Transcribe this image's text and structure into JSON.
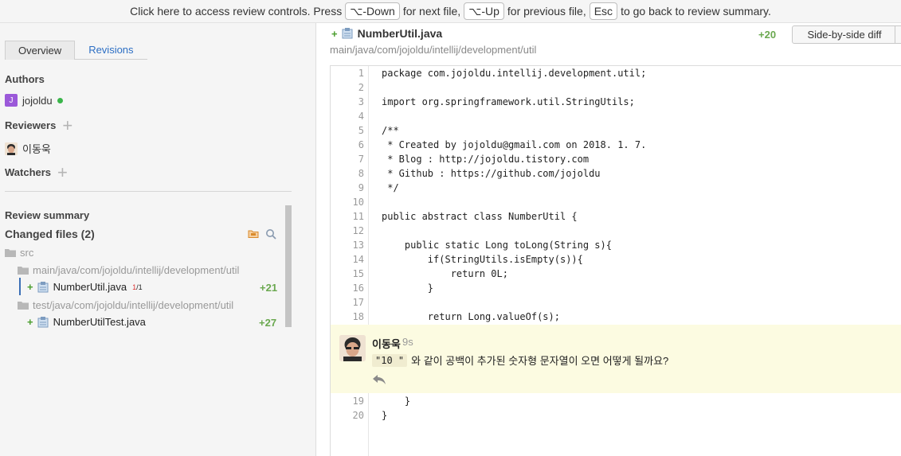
{
  "banner": {
    "text1": "Click here to access review controls. Press",
    "key_next": "⌥-Down",
    "text2": "for next file,",
    "key_prev": "⌥-Up",
    "text3": "for previous file,",
    "key_esc": "Esc",
    "text4": "to go back to review summary."
  },
  "sidebar": {
    "tabs": [
      {
        "label": "Overview",
        "active": true
      },
      {
        "label": "Revisions",
        "active": false
      }
    ],
    "authors_title": "Authors",
    "author": {
      "initial": "J",
      "name": "jojoldu",
      "online": true
    },
    "reviewers_title": "Reviewers",
    "reviewer": {
      "name": "이동욱"
    },
    "watchers_title": "Watchers",
    "review_summary": "Review summary",
    "changed_files": "Changed files (2)",
    "tree": {
      "root": "src",
      "folder1": "main/java/com/jojoldu/intellij/development/util",
      "file1": {
        "name": "NumberUtil.java",
        "comments_unread": "1",
        "comments_sep": "/",
        "comments_total": "1",
        "added": "+21"
      },
      "folder2": "test/java/com/jojoldu/intellij/development/util",
      "file2": {
        "name": "NumberUtilTest.java",
        "added": "+27"
      }
    }
  },
  "main": {
    "file_name": "NumberUtil.java",
    "file_path": "main/java/com/jojoldu/intellij/development/util",
    "added": "+20",
    "side_by_side": "Side-by-side diff",
    "lines_before": [
      {
        "n": "1",
        "code": "package com.jojoldu.intellij.development.util;"
      },
      {
        "n": "2",
        "code": ""
      },
      {
        "n": "3",
        "code": "import org.springframework.util.StringUtils;"
      },
      {
        "n": "4",
        "code": ""
      },
      {
        "n": "5",
        "code": "/**"
      },
      {
        "n": "6",
        "code": " * Created by jojoldu@gmail.com on 2018. 1. 7."
      },
      {
        "n": "7",
        "code": " * Blog : http://jojoldu.tistory.com"
      },
      {
        "n": "8",
        "code": " * Github : https://github.com/jojoldu"
      },
      {
        "n": "9",
        "code": " */"
      },
      {
        "n": "10",
        "code": ""
      },
      {
        "n": "11",
        "code": "public abstract class NumberUtil {"
      },
      {
        "n": "12",
        "code": ""
      },
      {
        "n": "13",
        "code": "    public static Long toLong(String s){"
      },
      {
        "n": "14",
        "code": "        if(StringUtils.isEmpty(s)){"
      },
      {
        "n": "15",
        "code": "            return 0L;"
      },
      {
        "n": "16",
        "code": "        }"
      },
      {
        "n": "17",
        "code": ""
      },
      {
        "n": "18",
        "code": "        return Long.valueOf(s);"
      }
    ],
    "comment": {
      "author": "이동욱",
      "time": "9s",
      "code_snippet": "\"10 \"",
      "text": "와 같이 공백이 추가된 숫자형 문자열이 오면 어떻게 될까요?"
    },
    "lines_after": [
      {
        "n": "19",
        "code": "    }"
      },
      {
        "n": "20",
        "code": "}"
      }
    ]
  },
  "colors": {
    "added": "#6aa84f",
    "link": "#2d6fc4",
    "comment_bg": "#fcfbe1"
  }
}
